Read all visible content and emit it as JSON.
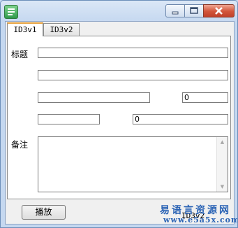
{
  "window": {
    "title": ""
  },
  "tabs": [
    {
      "label": "ID3v1",
      "active": true
    },
    {
      "label": "ID3v2",
      "active": false
    }
  ],
  "form": {
    "title_label": "标题",
    "remark_label": "备注",
    "title_value": "",
    "artist_value": "",
    "album_value": "",
    "year_value": "0",
    "genre_value": "",
    "track_value": "0",
    "remark_value": ""
  },
  "play_button_label": "播放",
  "status_text": "ID3v2",
  "watermark": {
    "cn": "易语言资源网",
    "url": "www.e5a5x.com"
  },
  "icons": {
    "app": "app-icon",
    "minimize": "minimize-icon",
    "maximize": "maximize-icon",
    "close": "close-icon"
  },
  "colors": {
    "accent_tab": "#e7a340",
    "close_button": "#d2553a",
    "watermark": "#2a63b5"
  }
}
